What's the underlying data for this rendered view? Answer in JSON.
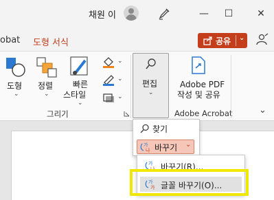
{
  "titlebar": {
    "user_name": "채원 이",
    "minimize": "—",
    "restore": "☐",
    "close": "✕"
  },
  "tabs": {
    "partial_left": "obat",
    "shape_format": "도형 서식"
  },
  "share": {
    "label": "공유",
    "caret": "⌄"
  },
  "ribbon": {
    "shape": "도형",
    "arrange": "정렬",
    "quick_styles_1": "빠른",
    "quick_styles_2": "스타일",
    "edit": "편집",
    "adobe_pdf_1": "Adobe PDF",
    "adobe_pdf_2": "작성 및 공유",
    "drawing_group": "그리기",
    "adobe_group": "Adobe Acrobat",
    "caret": "⌄",
    "collapse": "⌄"
  },
  "dropdown": {
    "find": "찾기",
    "replace": "바꾸기",
    "replace_caret": "⌄"
  },
  "submenu": {
    "replace_item": "바꾸기(R)...",
    "replace_fonts": "글꼴 바꾸기(O)..."
  },
  "colors": {
    "accent": "#c43e1c",
    "replace_highlight": "#f6c7b8",
    "annotation": "#f0e800"
  },
  "icons": {
    "avatar": "avatar-icon",
    "pen": "pen-icon",
    "search": "search-icon",
    "replace": "replace-icon",
    "share": "share-icon"
  }
}
